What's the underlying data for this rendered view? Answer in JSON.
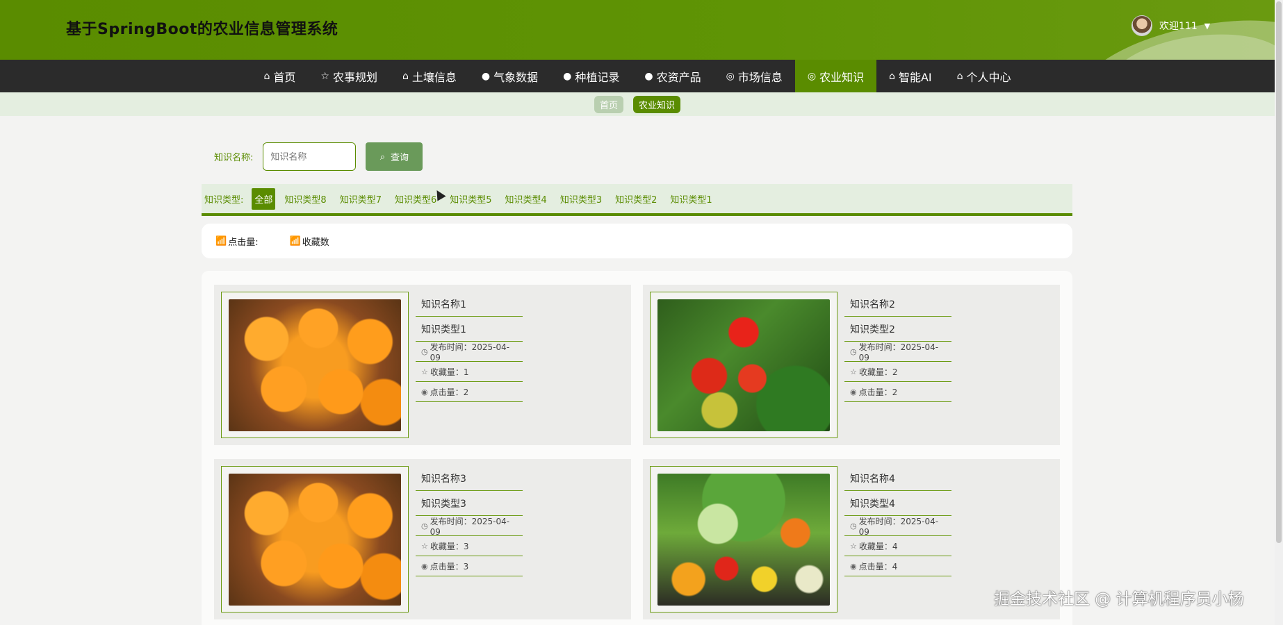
{
  "header": {
    "title": "基于SpringBoot的农业信息管理系统",
    "welcome": "欢迎111",
    "caret_icon": "caret-down-icon"
  },
  "nav": {
    "items": [
      {
        "icon": "⌂",
        "label": "首页",
        "active": false
      },
      {
        "icon": "☆",
        "label": "农事规划",
        "active": false
      },
      {
        "icon": "⌂",
        "label": "土壤信息",
        "active": false
      },
      {
        "icon": "●",
        "label": "气象数据",
        "active": false
      },
      {
        "icon": "●",
        "label": "种植记录",
        "active": false
      },
      {
        "icon": "●",
        "label": "农资产品",
        "active": false
      },
      {
        "icon": "◎",
        "label": "市场信息",
        "active": false
      },
      {
        "icon": "◎",
        "label": "农业知识",
        "active": true
      },
      {
        "icon": "⌂",
        "label": "智能AI",
        "active": false
      },
      {
        "icon": "⌂",
        "label": "个人中心",
        "active": false
      }
    ]
  },
  "breadcrumb": {
    "home": "首页",
    "current": "农业知识"
  },
  "search": {
    "label": "知识名称:",
    "placeholder": "知识名称",
    "button": "查询"
  },
  "types": {
    "label": "知识类型:",
    "items": [
      "全部",
      "知识类型8",
      "知识类型7",
      "知识类型6",
      "知识类型5",
      "知识类型4",
      "知识类型3",
      "知识类型2",
      "知识类型1"
    ]
  },
  "sort": {
    "clicks": "点击量:",
    "favorites": "收藏数"
  },
  "cards": [
    {
      "name": "知识名称1",
      "type": "知识类型1",
      "date": "发布时间：2025-04-09",
      "fav": "收藏量：1",
      "clicks": "点击量：2",
      "image": "loquat-fruits"
    },
    {
      "name": "知识名称2",
      "type": "知识类型2",
      "date": "发布时间：2025-04-09",
      "fav": "收藏量：2",
      "clicks": "点击量：2",
      "image": "tomato-plant"
    },
    {
      "name": "知识名称3",
      "type": "知识类型3",
      "date": "发布时间：2025-04-09",
      "fav": "收藏量：3",
      "clicks": "点击量：3",
      "image": "loquat-fruits"
    },
    {
      "name": "知识名称4",
      "type": "知识类型4",
      "date": "发布时间：2025-04-09",
      "fav": "收藏量：4",
      "clicks": "点击量：4",
      "image": "mixed-vegetables"
    }
  ],
  "watermark": "掘金技术社区 @ 计算机程序员小杨",
  "colors": {
    "brand": "#5a8c00",
    "nav_bg": "#2b2b2b",
    "breadcrumb_band": "#e4eee0"
  }
}
